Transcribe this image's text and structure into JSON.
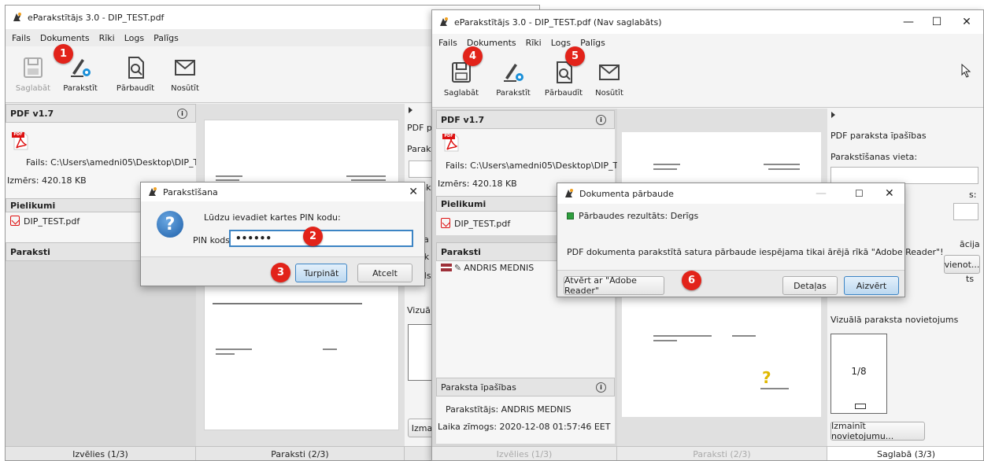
{
  "left_window": {
    "title": "eParakstītājs 3.0 - DIP_TEST.pdf",
    "menu": [
      "Fails",
      "Dokuments",
      "Rīki",
      "Logs",
      "Palīgs"
    ],
    "toolbar": {
      "save": "Saglabāt",
      "sign": "Parakstīt",
      "verify": "Pārbaudīt",
      "send": "Nosūtīt"
    },
    "doc_panel": {
      "header": "PDF v1.7",
      "file_label": "Fails: C:\\Users\\amedni05\\Desktop\\DIP_TEST",
      "size_label": "Izmērs: 420.18 KB"
    },
    "attachments": {
      "header": "Pielikumi",
      "items": [
        "DIP_TEST.pdf"
      ]
    },
    "signatures": {
      "header": "Paraksti"
    },
    "side_text": [
      "PDF p",
      "Parak",
      "Parak",
      "Pa",
      "ak",
      "els",
      "Vizuā",
      "Izma"
    ],
    "tabs": [
      "Izvēlies (1/3)",
      "Paraksti (2/3)"
    ]
  },
  "pin_dialog": {
    "title": "Parakstīšana",
    "prompt": "Lūdzu ievadiet kartes PIN kodu:",
    "pin_label": "PIN kods:",
    "pin_value": "••••••",
    "continue": "Turpināt",
    "cancel": "Atcelt"
  },
  "right_window": {
    "title": "eParakstītājs 3.0 - DIP_TEST.pdf (Nav saglabāts)",
    "menu": [
      "Fails",
      "Dokuments",
      "Rīki",
      "Logs",
      "Palīgs"
    ],
    "toolbar": {
      "save": "Saglabāt",
      "sign": "Parakstīt",
      "verify": "Pārbaudīt",
      "send": "Nosūtīt"
    },
    "doc_panel": {
      "header": "PDF v1.7",
      "file_label": "Fails: C:\\Users\\amedni05\\Desktop\\DIP_TES",
      "size_label": "Izmērs: 420.18 KB"
    },
    "attachments": {
      "header": "Pielikumi",
      "items": [
        "DIP_TEST.pdf"
      ]
    },
    "signatures": {
      "header": "Paraksti",
      "items": [
        "ANDRIS MEDNIS"
      ]
    },
    "signature_props": {
      "header": "Paraksta īpašības",
      "signer": "Parakstītājs: ANDRIS MEDNIS",
      "timestamp": "Laika zīmogs: 2020-12-08 01:57:46 EET"
    },
    "right_panel": {
      "section_title": "PDF paraksta īpašības",
      "place_label": "Parakstīšanas vieta:",
      "field2_label_tail": "s:",
      "field3_label_tail": "ācija",
      "add_btn_tail": "vienot...",
      "tail4": "ts",
      "visual_title": "Vizuālā paraksta novietojums",
      "page_indicator": "1/8",
      "change_btn": "Izmainīt novietojumu..."
    },
    "tabs": [
      "Izvēlies (1/3)",
      "Paraksti (2/3)",
      "Saglabā (3/3)"
    ]
  },
  "verify_dialog": {
    "title": "Dokumenta pārbaude",
    "result": "Pārbaudes rezultāts: Derīgs",
    "message": "PDF dokumenta parakstītā satura pārbaude iespējama tikai ārējā rīkā \"Adobe Reader\"!",
    "open_adobe": "Atvērt ar \"Adobe Reader\"",
    "details": "Detaļas",
    "close": "Aizvērt"
  },
  "badges": [
    "1",
    "2",
    "3",
    "4",
    "5",
    "6"
  ],
  "colors": {
    "badge": "#e2231a",
    "accent_blue": "#3c84c4",
    "valid_green": "#2e9e3e",
    "pdf_red": "#d11111"
  }
}
